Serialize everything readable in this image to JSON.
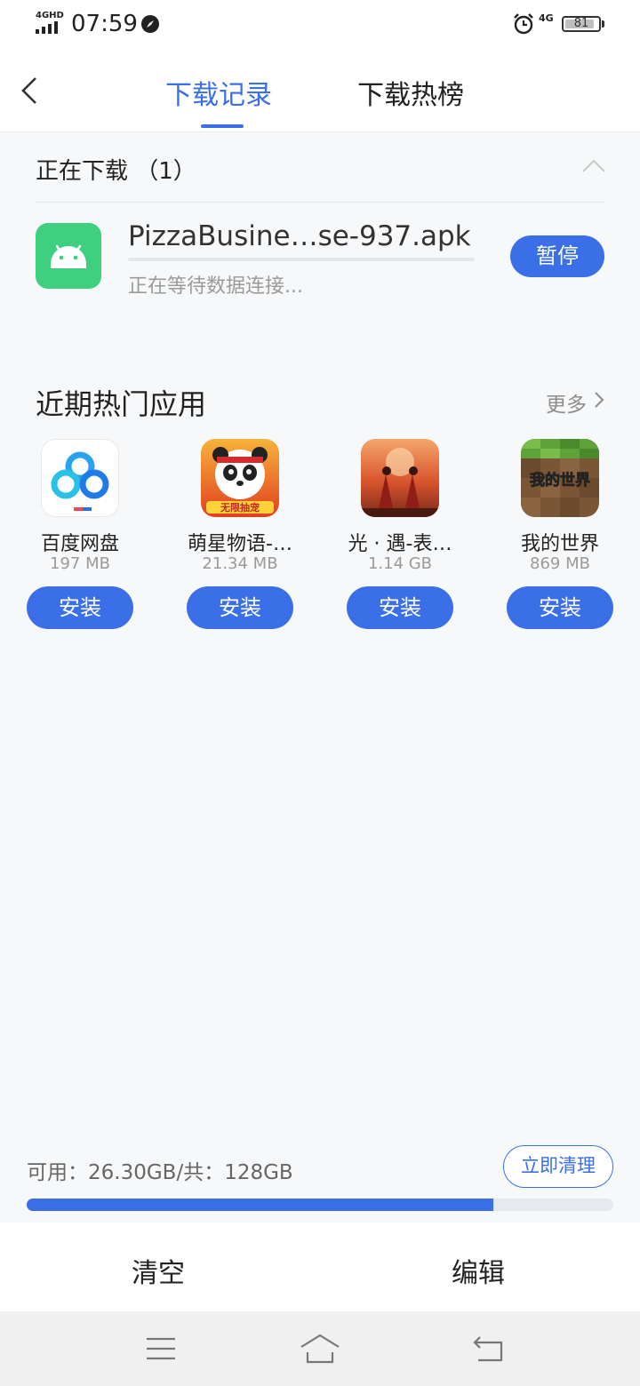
{
  "status_bar": {
    "signal_label": "4GHD",
    "time": "07:59",
    "network": "4G",
    "battery": "81"
  },
  "header": {
    "tabs": [
      {
        "label": "下载记录",
        "active": true
      },
      {
        "label": "下载热榜",
        "active": false
      }
    ]
  },
  "downloading": {
    "title": "正在下载 （1）",
    "item": {
      "name": "PizzaBusine…se-937.apk",
      "status": "正在等待数据连接...",
      "progress": 0,
      "button": "暂停"
    }
  },
  "hot_apps": {
    "title": "近期热门应用",
    "more": "更多",
    "apps": [
      {
        "name": "百度网盘",
        "size": "197 MB",
        "button": "安装",
        "icon": "baidu-netdisk-icon"
      },
      {
        "name": "萌星物语-…",
        "size": "21.34 MB",
        "button": "安装",
        "icon": "panda-game-icon",
        "badge": "无限抽宠"
      },
      {
        "name": "光 · 遇-表…",
        "size": "1.14 GB",
        "button": "安装",
        "icon": "sky-game-icon"
      },
      {
        "name": "我的世界",
        "size": "869 MB",
        "button": "安装",
        "icon": "minecraft-icon",
        "badge": "我的世界"
      }
    ]
  },
  "storage": {
    "text": "可用：26.30GB/共：128GB",
    "used_fraction": 0.795,
    "button": "立即清理"
  },
  "actions": {
    "clear": "清空",
    "edit": "编辑"
  },
  "colors": {
    "accent": "#3b6fe8",
    "android_green": "#3ecf7f"
  }
}
